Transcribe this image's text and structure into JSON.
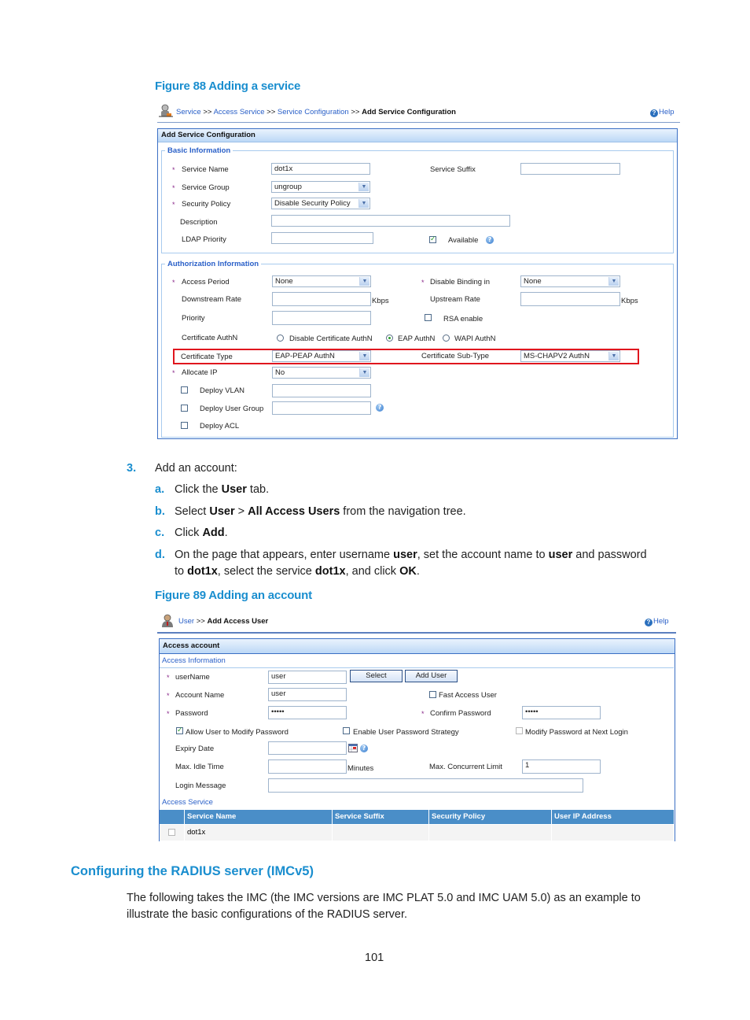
{
  "figure88": {
    "caption": "Figure 88 Adding a service",
    "breadcrumb": [
      {
        "label": "Service",
        "link": true
      },
      {
        "label": ">>",
        "link": false
      },
      {
        "label": "Access Service",
        "link": true
      },
      {
        "label": ">>",
        "link": false
      },
      {
        "label": "Service Configuration",
        "link": true
      },
      {
        "label": ">>",
        "link": false
      },
      {
        "label": "Add Service Configuration",
        "link": false
      }
    ],
    "help_label": "Help",
    "panel_title": "Add Service Configuration",
    "basic": {
      "legend": "Basic Information",
      "service_name_label": "Service Name",
      "service_name_value": "dot1x",
      "service_suffix_label": "Service Suffix",
      "service_suffix_value": "",
      "service_group_label": "Service Group",
      "service_group_value": "ungroup",
      "security_policy_label": "Security Policy",
      "security_policy_value": "Disable Security Policy",
      "description_label": "Description",
      "description_value": "",
      "ldap_priority_label": "LDAP Priority",
      "ldap_priority_value": "",
      "available_label": "Available",
      "available_checked": true
    },
    "auth": {
      "legend": "Authorization Information",
      "access_period_label": "Access Period",
      "access_period_value": "None",
      "disable_binding_label": "Disable Binding in",
      "disable_binding_value": "None",
      "downstream_label": "Downstream Rate",
      "downstream_value": "",
      "downstream_unit": "Kbps",
      "upstream_label": "Upstream Rate",
      "upstream_value": "",
      "upstream_unit": "Kbps",
      "priority_label": "Priority",
      "priority_value": "",
      "rsa_label": "RSA enable",
      "rsa_checked": false,
      "cert_authn_label": "Certificate AuthN",
      "cert_authn_options": [
        "Disable Certificate AuthN",
        "EAP AuthN",
        "WAPI AuthN"
      ],
      "cert_authn_selected": "EAP AuthN",
      "cert_type_label": "Certificate Type",
      "cert_type_value": "EAP-PEAP AuthN",
      "cert_subtype_label": "Certificate Sub-Type",
      "cert_subtype_value": "MS-CHAPV2 AuthN",
      "allocate_ip_label": "Allocate IP",
      "allocate_ip_value": "No",
      "deploy_vlan_label": "Deploy VLAN",
      "deploy_vlan_value": "",
      "deploy_user_group_label": "Deploy User Group",
      "deploy_user_group_value": "",
      "deploy_acl_label": "Deploy ACL"
    }
  },
  "steps": {
    "step3_num": "3.",
    "step3_text": "Add an account:",
    "a_letter": "a.",
    "a_pre": "Click the ",
    "a_bold": "User",
    "a_post": " tab.",
    "b_letter": "b.",
    "b_pre": "Select ",
    "b_bold1": "User",
    "b_mid": " > ",
    "b_bold2": "All Access Users",
    "b_post": " from the navigation tree.",
    "c_letter": "c.",
    "c_pre": "Click ",
    "c_bold": "Add",
    "c_post": ".",
    "d_letter": "d.",
    "d_line1_pre": "On the page that appears, enter username ",
    "d_line1_bold1": "user",
    "d_line1_mid": ", set the account name to ",
    "d_line1_bold2": "user",
    "d_line1_post": " and password",
    "d_line2_pre": "to ",
    "d_line2_bold1": "dot1x",
    "d_line2_mid": ", select the service ",
    "d_line2_bold2": "dot1x",
    "d_line2_mid2": ", and click ",
    "d_line2_bold3": "OK",
    "d_line2_post": "."
  },
  "figure89": {
    "caption": "Figure 89 Adding an account",
    "breadcrumb_link": "User",
    "breadcrumb_sep": ">>",
    "breadcrumb_current": "Add Access User",
    "help_label": "Help",
    "panel_title": "Access account",
    "section_access_info": "Access Information",
    "username_label": "userName",
    "username_value": "user",
    "select_button": "Select",
    "add_user_button": "Add User",
    "account_name_label": "Account Name",
    "account_name_value": "user",
    "fast_access_label": "Fast Access User",
    "password_label": "Password",
    "password_value": "•••••",
    "confirm_password_label": "Confirm Password",
    "confirm_password_value": "•••••",
    "allow_modify_label": "Allow User to Modify Password",
    "allow_modify_checked": true,
    "enable_strategy_label": "Enable User Password Strategy",
    "modify_next_login_label": "Modify Password at Next Login",
    "expiry_label": "Expiry Date",
    "expiry_value": "",
    "max_idle_label": "Max. Idle Time",
    "max_idle_value": "",
    "max_idle_unit": "Minutes",
    "max_concurrent_label": "Max. Concurrent Limit",
    "max_concurrent_value": "1",
    "login_message_label": "Login Message",
    "login_message_value": "",
    "section_access_service": "Access Service",
    "table_headers": [
      "Service Name",
      "Service Suffix",
      "Security Policy",
      "User IP Address"
    ],
    "table_rows": [
      {
        "service_name": "dot1x",
        "service_suffix": "",
        "security_policy": "",
        "user_ip": ""
      }
    ]
  },
  "section": {
    "heading": "Configuring the RADIUS server (IMCv5)",
    "para_line1": "The following takes the IMC (the IMC versions are IMC PLAT 5.0 and IMC UAM 5.0) as an example to",
    "para_line2": "illustrate the basic configurations of the RADIUS server."
  },
  "page_number": "101",
  "colors": {
    "heading_blue": "#1a8ecf",
    "link_blue": "#2a60c8",
    "highlight_red": "#e0161e",
    "table_header_blue": "#4a8ec8"
  }
}
